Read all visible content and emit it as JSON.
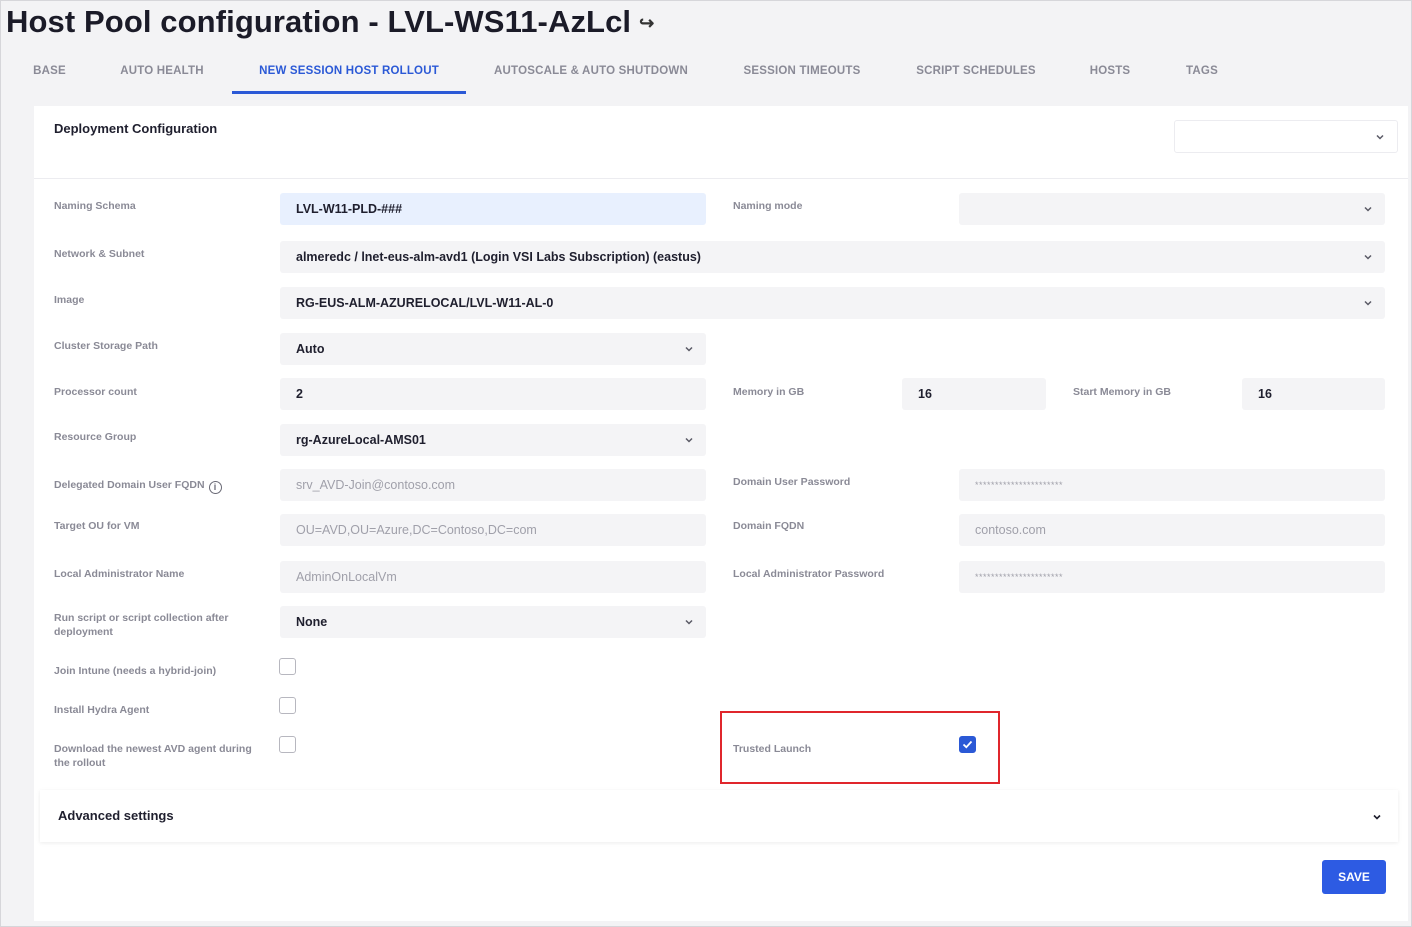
{
  "page": {
    "title": "Host Pool configuration - LVL-WS11-AzLcl",
    "title_icon": "undo-arrow-icon"
  },
  "tabs": [
    {
      "label": "BASE",
      "active": false
    },
    {
      "label": "AUTO HEALTH",
      "active": false
    },
    {
      "label": "NEW SESSION HOST ROLLOUT",
      "active": true
    },
    {
      "label": "AUTOSCALE & AUTO SHUTDOWN",
      "active": false
    },
    {
      "label": "SESSION TIMEOUTS",
      "active": false
    },
    {
      "label": "SCRIPT SCHEDULES",
      "active": false
    },
    {
      "label": "HOSTS",
      "active": false
    },
    {
      "label": "TAGS",
      "active": false
    }
  ],
  "section": {
    "title": "Deployment Configuration",
    "top_select_value": ""
  },
  "form": {
    "naming_schema": {
      "label": "Naming Schema",
      "value": "LVL-W11-PLD-###"
    },
    "naming_mode": {
      "label": "Naming mode",
      "value": ""
    },
    "network_subnet": {
      "label": "Network & Subnet",
      "value": "almeredc / lnet-eus-alm-avd1 (Login VSI Labs Subscription) (eastus)"
    },
    "image": {
      "label": "Image",
      "value": "RG-EUS-ALM-AZURELOCAL/LVL-W11-AL-0"
    },
    "cluster_storage_path": {
      "label": "Cluster Storage Path",
      "value": "Auto"
    },
    "processor_count": {
      "label": "Processor count",
      "value": "2"
    },
    "memory_gb": {
      "label": "Memory in GB",
      "value": "16"
    },
    "start_memory_gb": {
      "label": "Start Memory in GB",
      "value": "16"
    },
    "resource_group": {
      "label": "Resource Group",
      "value": "rg-AzureLocal-AMS01"
    },
    "delegated_domain_user": {
      "label": "Delegated Domain User FQDN",
      "placeholder": "srv_AVD-Join@contoso.com"
    },
    "domain_user_password": {
      "label": "Domain User Password",
      "value": "**********************"
    },
    "target_ou": {
      "label": "Target OU for VM",
      "placeholder": "OU=AVD,OU=Azure,DC=Contoso,DC=com"
    },
    "domain_fqdn": {
      "label": "Domain FQDN",
      "placeholder": "contoso.com"
    },
    "local_admin_name": {
      "label": "Local Administrator Name",
      "placeholder": "AdminOnLocalVm"
    },
    "local_admin_password": {
      "label": "Local Administrator Password",
      "value": "**********************"
    },
    "run_script": {
      "label_line1": "Run script or script collection after",
      "label_line2": "deployment",
      "value": "None"
    },
    "join_intune": {
      "label": "Join Intune (needs a hybrid-join)",
      "checked": false
    },
    "install_hydra": {
      "label": "Install Hydra Agent",
      "checked": false
    },
    "download_avd": {
      "label_line1": "Download the newest AVD agent during",
      "label_line2": "the rollout",
      "checked": false
    },
    "trusted_launch": {
      "label": "Trusted Launch",
      "checked": true
    }
  },
  "advanced": {
    "title": "Advanced settings"
  },
  "actions": {
    "save_label": "SAVE"
  },
  "colors": {
    "accent": "#2b59d6",
    "highlight_box": "#e0262c",
    "save_button": "#2d5be3"
  }
}
